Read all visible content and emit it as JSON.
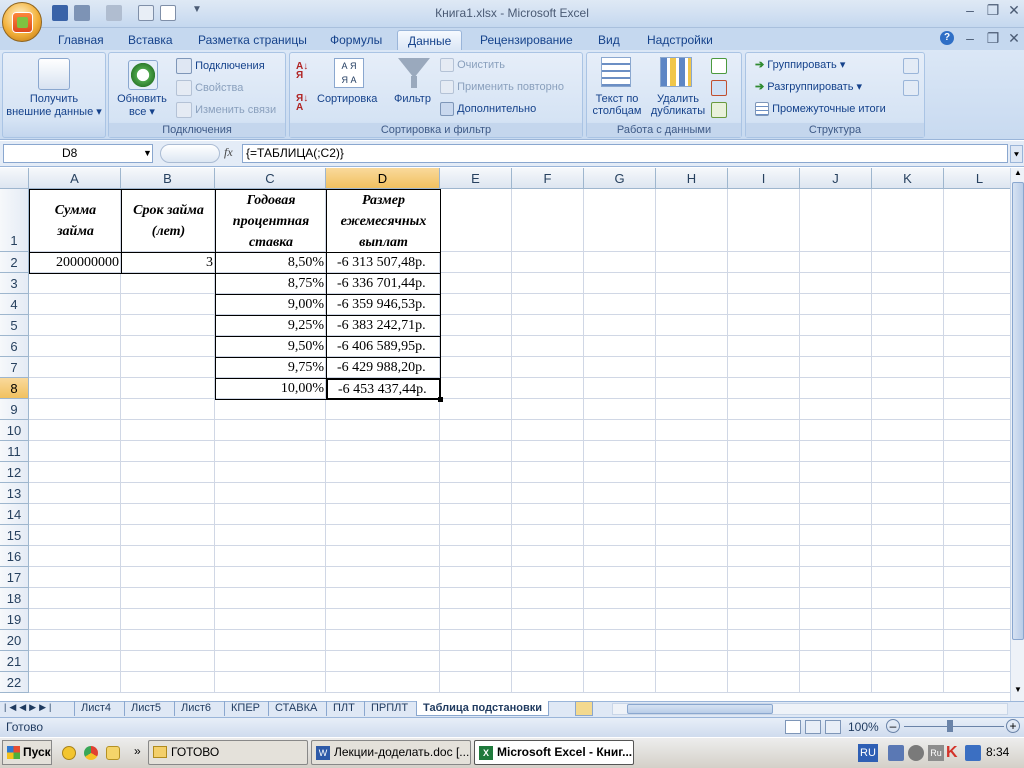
{
  "window": {
    "title": "Книга1.xlsx - Microsoft Excel"
  },
  "ribbon": {
    "tabs": [
      "Главная",
      "Вставка",
      "Разметка страницы",
      "Формулы",
      "Данные",
      "Рецензирование",
      "Вид",
      "Надстройки"
    ],
    "active_tab": "Данные",
    "groups": {
      "external": {
        "label_line1": "Получить",
        "label_line2": "внешние данные"
      },
      "connections": {
        "label": "Подключения",
        "refresh_line1": "Обновить",
        "refresh_line2": "все",
        "items": [
          "Подключения",
          "Свойства",
          "Изменить связи"
        ]
      },
      "sortfilter": {
        "label": "Сортировка и фильтр",
        "sort": "Сортировка",
        "filter": "Фильтр",
        "items": [
          "Очистить",
          "Применить повторно",
          "Дополнительно"
        ]
      },
      "datatools": {
        "label": "Работа с данными",
        "text_line1": "Текст по",
        "text_line2": "столбцам",
        "dup_line1": "Удалить",
        "dup_line2": "дубликаты"
      },
      "outline": {
        "label": "Структура",
        "items": [
          "Группировать",
          "Разгруппировать",
          "Промежуточные итоги"
        ]
      }
    }
  },
  "formula_bar": {
    "name_box": "D8",
    "fx": "fx",
    "formula": "{=ТАБЛИЦА(;C2)}"
  },
  "sheet": {
    "columns": [
      "A",
      "B",
      "C",
      "D",
      "E",
      "F",
      "G",
      "H",
      "I",
      "J",
      "K",
      "L"
    ],
    "rows": [
      "1",
      "2",
      "3",
      "4",
      "5",
      "6",
      "7",
      "8",
      "9",
      "10",
      "11",
      "12",
      "13",
      "14",
      "15",
      "16",
      "17",
      "18",
      "19",
      "20",
      "21",
      "22"
    ],
    "headers": {
      "A": [
        "Сумма",
        "займа"
      ],
      "B": [
        "Срок займа",
        "(лет)"
      ],
      "C": [
        "Годовая",
        "процентная",
        "ставка"
      ],
      "D": [
        "Размер",
        "ежемесячных",
        "выплат"
      ]
    },
    "a2": "200000000",
    "b2": "3",
    "rates": [
      "8,50%",
      "8,75%",
      "9,00%",
      "9,25%",
      "9,50%",
      "9,75%",
      "10,00%"
    ],
    "payments": [
      "-6 313 507,48р.",
      "-6 336 701,44р.",
      "-6 359 946,53р.",
      "-6 383 242,71р.",
      "-6 406 589,95р.",
      "-6 429 988,20р.",
      "-6 453 437,44р."
    ]
  },
  "sheet_tabs": [
    "Лист4",
    "Лист5",
    "Лист6",
    "КПЕР",
    "СТАВКА",
    "ПЛТ",
    "ПРПЛТ",
    "Таблица подстановки"
  ],
  "active_sheet": "Таблица подстановки",
  "status": {
    "ready": "Готово",
    "zoom": "100%"
  },
  "taskbar": {
    "start": "Пуск",
    "buttons": [
      "ГОТОВО",
      "Лекции-доделать.doc [...",
      "Microsoft Excel - Книг..."
    ],
    "lang": "RU",
    "time": "8:34"
  }
}
